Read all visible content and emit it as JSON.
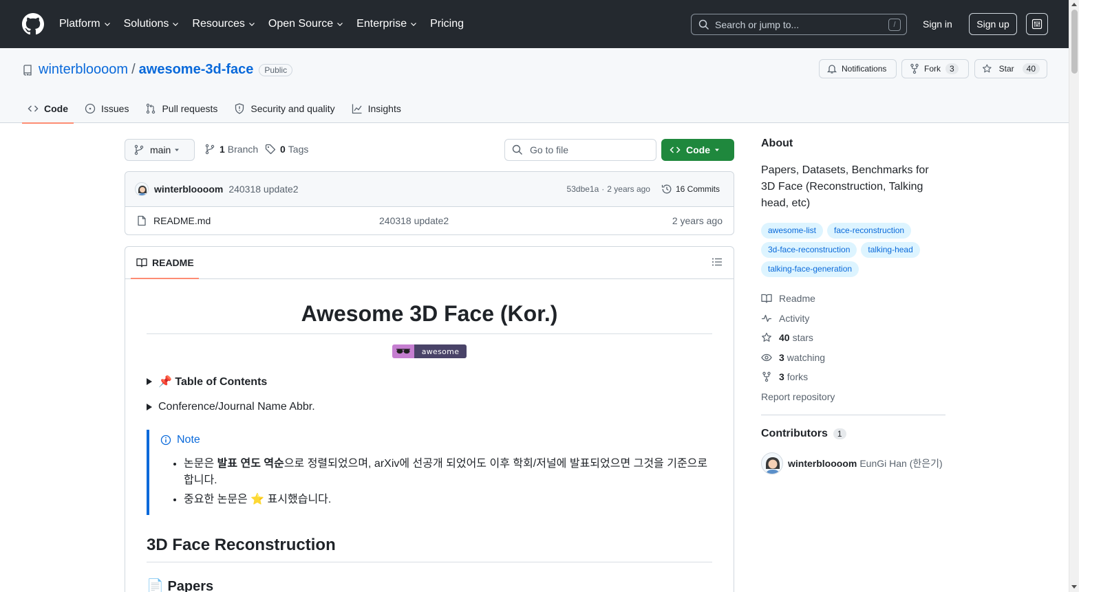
{
  "header": {
    "nav": [
      "Platform",
      "Solutions",
      "Resources",
      "Open Source",
      "Enterprise",
      "Pricing"
    ],
    "search_placeholder": "Search or jump to...",
    "search_shortcut": "/",
    "signin": "Sign in",
    "signup": "Sign up"
  },
  "repo": {
    "owner": "winterbloooom",
    "separator": "/",
    "name": "awesome-3d-face",
    "visibility": "Public",
    "notifications": "Notifications",
    "fork_label": "Fork",
    "fork_count": "3",
    "star_label": "Star",
    "star_count": "40",
    "tabs": [
      "Code",
      "Issues",
      "Pull requests",
      "Security and quality",
      "Insights"
    ]
  },
  "files": {
    "branch": "main",
    "branch_count": "1",
    "branch_label": "Branch",
    "tag_count": "0",
    "tag_label": "Tags",
    "goto_placeholder": "Go to file",
    "code_button": "Code",
    "commit": {
      "author": "winterbloooom",
      "message": "240318 update2",
      "hash": "53dbe1a",
      "dot": "·",
      "age": "2 years ago",
      "commits": "16 Commits"
    },
    "rows": [
      {
        "name": "README.md",
        "message": "240318 update2",
        "age": "2 years ago"
      }
    ]
  },
  "readme": {
    "tab": "README",
    "title": "Awesome 3D Face (Kor.)",
    "badge_text": "awesome",
    "details": [
      "📌 Table of Contents",
      "Conference/Journal Name Abbr."
    ],
    "note_title": "Note",
    "note_items": [
      {
        "before": "논문은 ",
        "bold": "발표 연도 역순",
        "after": "으로 정렬되었으며, arXiv에 선공개 되었어도 이후 학회/저널에 발표되었으면 그것을 기준으로 합니다."
      },
      {
        "before": "중요한 논문은 ",
        "bold": "",
        "after": "⭐ 표시했습니다."
      }
    ],
    "section": "3D Face Reconstruction",
    "subsection": "📄 Papers"
  },
  "about": {
    "heading": "About",
    "description": "Papers, Datasets, Benchmarks for 3D Face (Reconstruction, Talking head, etc)",
    "topics": [
      "awesome-list",
      "face-reconstruction",
      "3d-face-reconstruction",
      "talking-head",
      "talking-face-generation"
    ],
    "links": {
      "readme": "Readme",
      "activity": "Activity",
      "stars_count": "40",
      "stars_label": "stars",
      "watching_count": "3",
      "watching_label": "watching",
      "forks_count": "3",
      "forks_label": "forks"
    },
    "report": "Report repository",
    "contributors_heading": "Contributors",
    "contributors_count": "1",
    "contributor": {
      "login": "winterbloooom",
      "full_name": "EunGi Han (한은기)"
    }
  },
  "colors": {
    "header_bg": "#24292f",
    "link": "#0969da",
    "primary_button": "#1f883d",
    "tab_underline": "#fd8c73",
    "topic_bg": "#ddf4ff"
  }
}
